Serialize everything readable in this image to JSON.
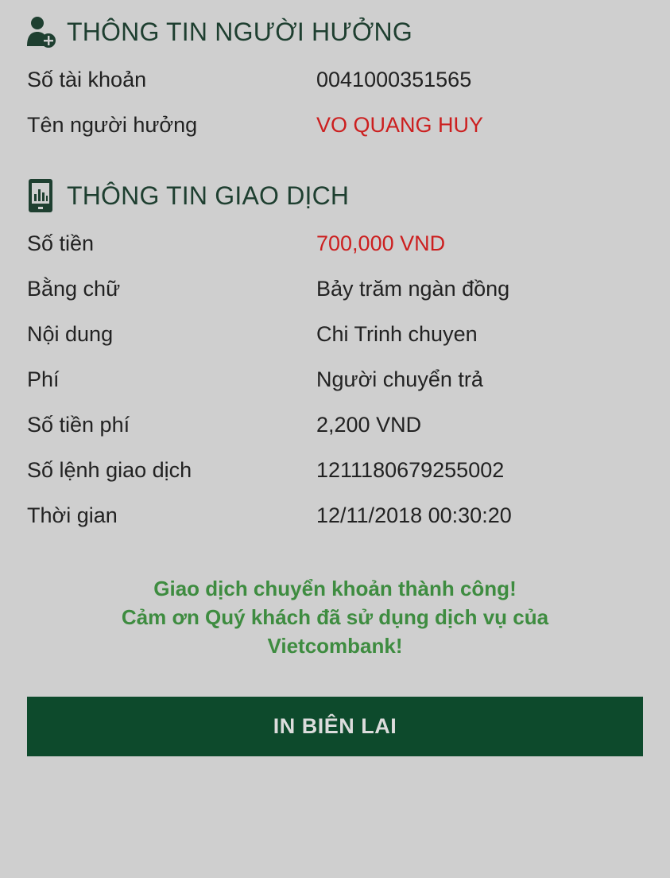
{
  "beneficiary": {
    "title": "THÔNG TIN NGƯỜI HƯỞNG",
    "icon": "person-add-icon",
    "rows": [
      {
        "label": "Số tài khoản",
        "value": "0041000351565"
      },
      {
        "label": "Tên người hưởng",
        "value": "VO QUANG HUY"
      }
    ]
  },
  "transaction": {
    "title": "THÔNG TIN GIAO DỊCH",
    "icon": "chart-device-icon",
    "rows": [
      {
        "label": "Số tiền",
        "value": "700,000 VND"
      },
      {
        "label": "Bằng chữ",
        "value": "Bảy trăm ngàn đồng"
      },
      {
        "label": "Nội dung",
        "value": "Chi Trinh chuyen"
      },
      {
        "label": "Phí",
        "value": "Người chuyển trả"
      },
      {
        "label": "Số tiền phí",
        "value": "2,200 VND"
      },
      {
        "label": "Số lệnh giao dịch",
        "value": "1211180679255002"
      },
      {
        "label": "Thời gian",
        "value": "12/11/2018 00:30:20"
      }
    ]
  },
  "message": {
    "line1": "Giao dịch chuyển khoản thành công!",
    "line2": "Cảm ơn Quý khách đã sử dụng dịch vụ của",
    "line3": "Vietcombank!"
  },
  "print_button": {
    "label": "IN BIÊN LAI"
  },
  "colors": {
    "background": "#cfcfcf",
    "heading": "#1e3f30",
    "highlight_red": "#cc1f1f",
    "success_green": "#3e8c40",
    "button_green": "#0d4a2c"
  }
}
